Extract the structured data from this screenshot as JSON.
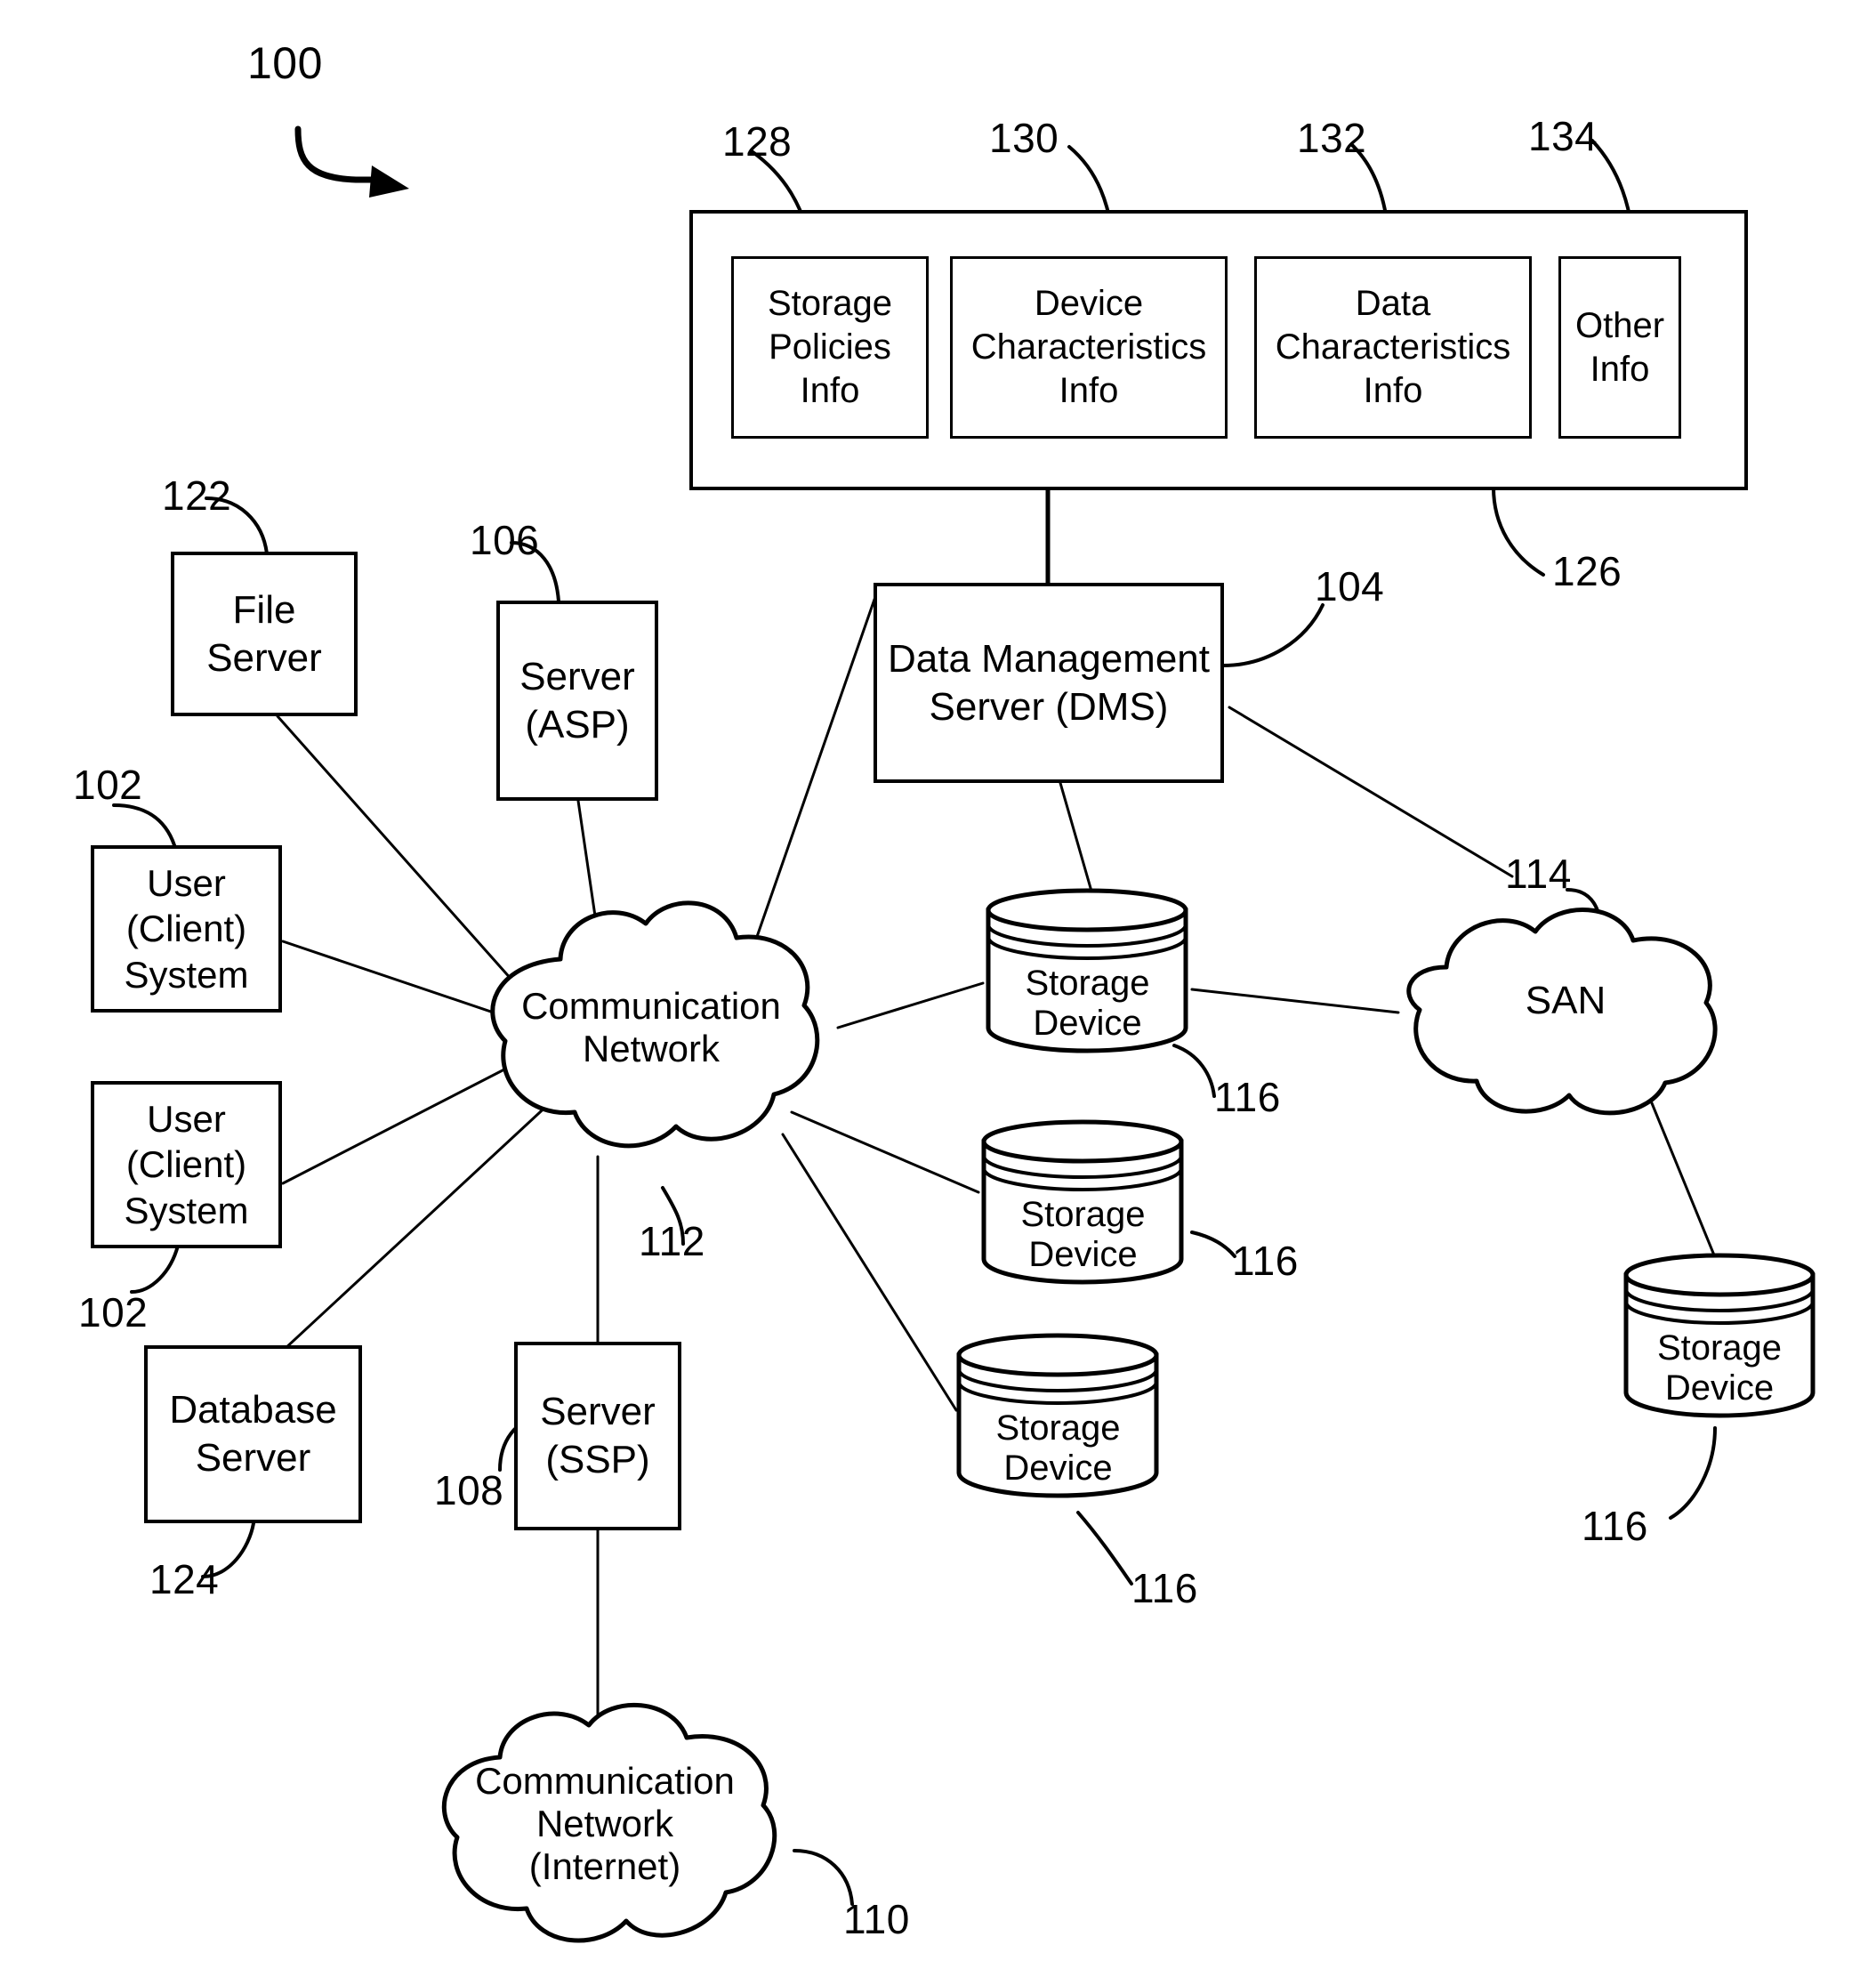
{
  "figure": {
    "number": "100"
  },
  "repository": {
    "ref": "126",
    "items": [
      {
        "ref": "128",
        "lines": [
          "Storage",
          "Policies",
          "Info"
        ]
      },
      {
        "ref": "130",
        "lines": [
          "Device",
          "Characteristics",
          "Info"
        ]
      },
      {
        "ref": "132",
        "lines": [
          "Data",
          "Characteristics",
          "Info"
        ]
      },
      {
        "ref": "134",
        "lines": [
          "Other",
          "Info"
        ]
      }
    ]
  },
  "nodes": {
    "dms": {
      "ref": "104",
      "lines": [
        "Data Management",
        "Server (DMS)"
      ]
    },
    "file_server": {
      "ref": "122",
      "lines": [
        "File",
        "Server"
      ]
    },
    "server_asp": {
      "ref": "106",
      "lines": [
        "Server",
        "(ASP)"
      ]
    },
    "server_ssp": {
      "ref": "108",
      "lines": [
        "Server",
        "(SSP)"
      ]
    },
    "database_server": {
      "ref": "124",
      "lines": [
        "Database",
        "Server"
      ]
    },
    "user_client_1": {
      "ref": "102",
      "lines": [
        "User",
        "(Client)",
        "System"
      ]
    },
    "user_client_2": {
      "ref": "102",
      "lines": [
        "User",
        "(Client)",
        "System"
      ]
    }
  },
  "clouds": {
    "comm_network": {
      "ref": "112",
      "lines": [
        "Communication",
        "Network"
      ]
    },
    "san": {
      "ref": "114",
      "lines": [
        "SAN"
      ]
    },
    "internet": {
      "ref": "110",
      "lines": [
        "Communication",
        "Network",
        "(Internet)"
      ]
    }
  },
  "storage_devices": [
    {
      "ref": "116",
      "lines": [
        "Storage",
        "Device"
      ]
    },
    {
      "ref": "116",
      "lines": [
        "Storage",
        "Device"
      ]
    },
    {
      "ref": "116",
      "lines": [
        "Storage",
        "Device"
      ]
    },
    {
      "ref": "116",
      "lines": [
        "Storage",
        "Device"
      ]
    }
  ],
  "colors": {
    "ink": "#000000",
    "paper": "#ffffff"
  }
}
